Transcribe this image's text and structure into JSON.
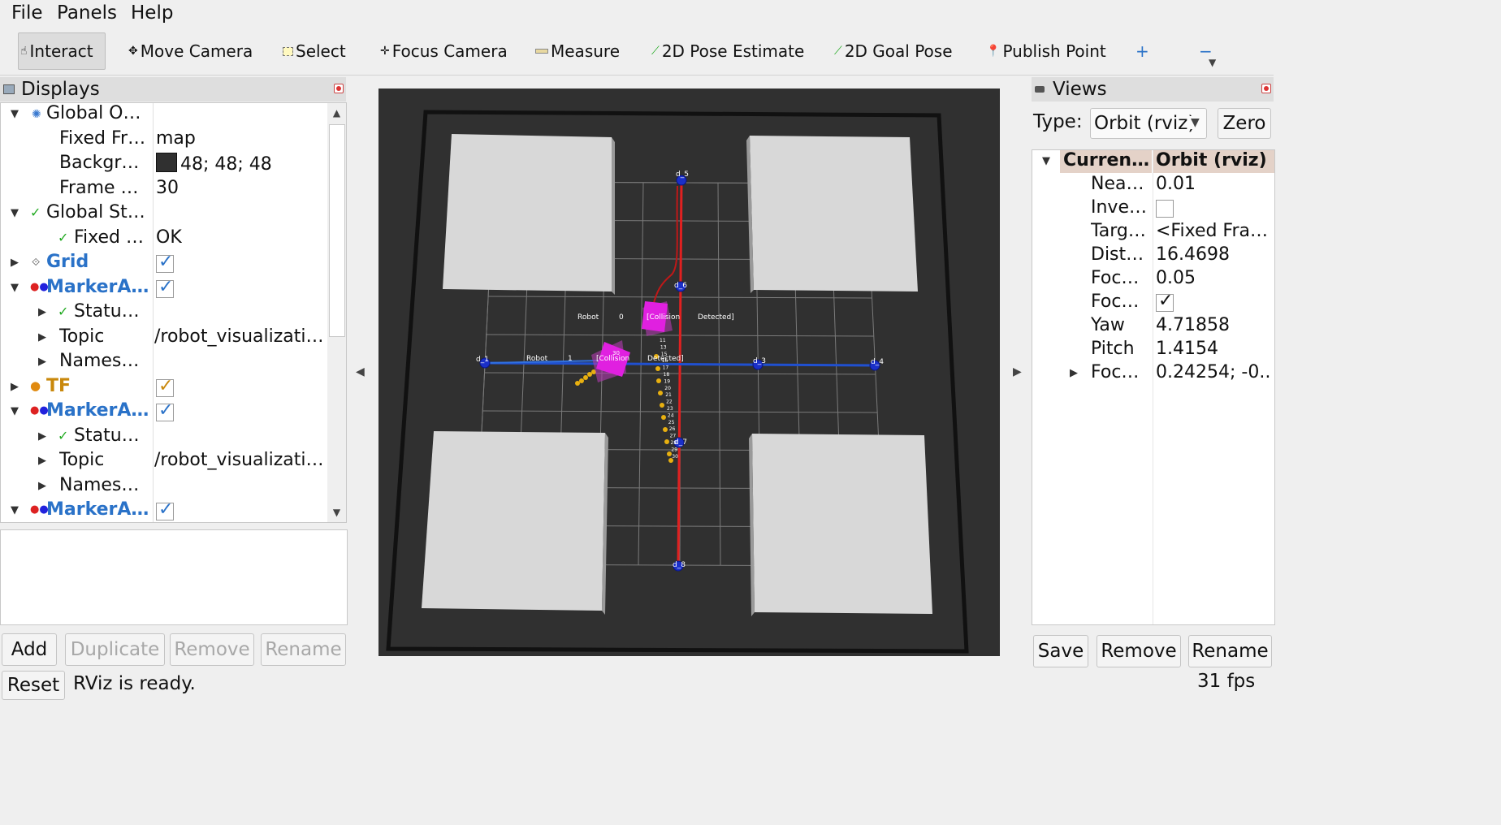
{
  "menu": {
    "file": "File",
    "panels": "Panels",
    "help": "Help"
  },
  "toolbar": {
    "interact": "Interact",
    "move_camera": "Move Camera",
    "select": "Select",
    "focus_camera": "Focus Camera",
    "measure": "Measure",
    "pose_estimate": "2D Pose Estimate",
    "goal_pose": "2D Goal Pose",
    "publish_point": "Publish Point",
    "plus": "+",
    "minus": "−"
  },
  "displays": {
    "title": "Displays",
    "rows": [
      {
        "label": "Global O…",
        "value": ""
      },
      {
        "label": "Fixed Fr…",
        "value": "map"
      },
      {
        "label": "Backgr…",
        "value": "48; 48; 48"
      },
      {
        "label": "Frame …",
        "value": "30"
      },
      {
        "label": "Global St…",
        "value": ""
      },
      {
        "label": "Fixed …",
        "value": "OK"
      },
      {
        "label": "Grid",
        "value": ""
      },
      {
        "label": "MarkerA…",
        "value": ""
      },
      {
        "label": "Statu…",
        "value": ""
      },
      {
        "label": "Topic",
        "value": "/robot_visualizati…"
      },
      {
        "label": "Names…",
        "value": ""
      },
      {
        "label": "TF",
        "value": ""
      },
      {
        "label": "MarkerA…",
        "value": ""
      },
      {
        "label": "Statu…",
        "value": ""
      },
      {
        "label": "Topic",
        "value": "/robot_visualizati…"
      },
      {
        "label": "Names…",
        "value": ""
      },
      {
        "label": "MarkerA…",
        "value": ""
      }
    ],
    "background_color": "#303030"
  },
  "buttons": {
    "add": "Add",
    "duplicate": "Duplicate",
    "remove": "Remove",
    "rename": "Rename",
    "reset": "Reset",
    "save": "Save",
    "views_remove": "Remove",
    "views_rename": "Rename",
    "zero": "Zero"
  },
  "status": {
    "message": "RViz is ready.",
    "fps": "31 fps"
  },
  "scene": {
    "robot": "Robot",
    "robot0": "0",
    "robot1": "1",
    "collision": "[Collision",
    "detected": "Detected]",
    "n1": "d_1",
    "n3": "d_3",
    "n4": "d_4",
    "n5": "d_5",
    "n6": "d_6",
    "n7": "d_7",
    "n8": "d_8",
    "n30": "30",
    "path_labels": [
      "11",
      "13",
      "15",
      "16",
      "17",
      "18",
      "19",
      "20",
      "21",
      "22",
      "23",
      "24",
      "25",
      "26",
      "27",
      "28",
      "29",
      "30"
    ]
  },
  "views": {
    "title": "Views",
    "type_label": "Type:",
    "type_value": "Orbit (rviz)",
    "header_label": "Curren…",
    "header_value": "Orbit (rviz)",
    "rows": [
      {
        "label": "Nea…",
        "value": "0.01"
      },
      {
        "label": "Inve…",
        "value": ""
      },
      {
        "label": "Targ…",
        "value": "<Fixed Fra…"
      },
      {
        "label": "Dist…",
        "value": "16.4698"
      },
      {
        "label": "Foc…",
        "value": "0.05"
      },
      {
        "label": "Foc…",
        "value": ""
      },
      {
        "label": "Yaw",
        "value": "4.71858"
      },
      {
        "label": "Pitch",
        "value": "1.4154"
      },
      {
        "label": "Foc…",
        "value": "0.24254; -0.…"
      }
    ]
  },
  "colors": {
    "accent_blue": "#2a72c8",
    "warning_orange": "#c9880c",
    "path_red": "#e02020",
    "path_blue": "#2050d0",
    "marker_magenta": "#e020e0",
    "trail_yellow": "#e8b010"
  }
}
